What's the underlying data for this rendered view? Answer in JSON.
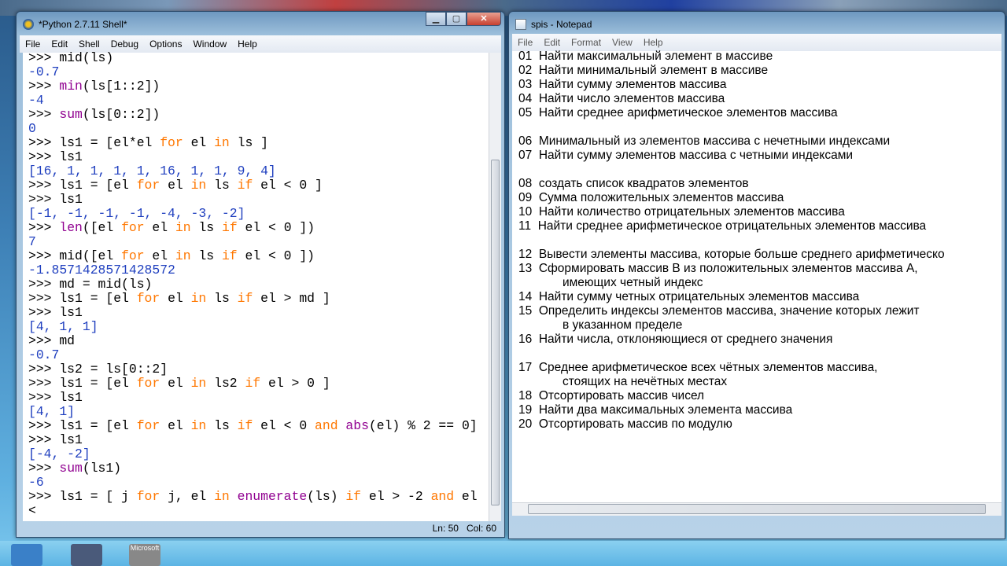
{
  "shell": {
    "title": "*Python 2.7.11 Shell*",
    "menu": [
      "File",
      "Edit",
      "Shell",
      "Debug",
      "Options",
      "Window",
      "Help"
    ],
    "lines": [
      [
        [
          "n",
          ">>> mid(ls)"
        ]
      ],
      [
        [
          "o",
          "-0.7"
        ]
      ],
      [
        [
          "n",
          ">>> "
        ],
        [
          "b",
          "min"
        ],
        [
          "n",
          "(ls[1::2])"
        ]
      ],
      [
        [
          "o",
          "-4"
        ]
      ],
      [
        [
          "n",
          ">>> "
        ],
        [
          "b",
          "sum"
        ],
        [
          "n",
          "(ls[0::2])"
        ]
      ],
      [
        [
          "o",
          "0"
        ]
      ],
      [
        [
          "n",
          ">>> ls1 = [el*el "
        ],
        [
          "k",
          "for"
        ],
        [
          "n",
          " el "
        ],
        [
          "k",
          "in"
        ],
        [
          "n",
          " ls ]"
        ]
      ],
      [
        [
          "n",
          ">>> ls1"
        ]
      ],
      [
        [
          "o",
          "[16, 1, 1, 1, 1, 16, 1, 1, 9, 4]"
        ]
      ],
      [
        [
          "n",
          ">>> ls1 = [el "
        ],
        [
          "k",
          "for"
        ],
        [
          "n",
          " el "
        ],
        [
          "k",
          "in"
        ],
        [
          "n",
          " ls "
        ],
        [
          "k",
          "if"
        ],
        [
          "n",
          " el < 0 ]"
        ]
      ],
      [
        [
          "n",
          ">>> ls1"
        ]
      ],
      [
        [
          "o",
          "[-1, -1, -1, -1, -4, -3, -2]"
        ]
      ],
      [
        [
          "n",
          ">>> "
        ],
        [
          "b",
          "len"
        ],
        [
          "n",
          "([el "
        ],
        [
          "k",
          "for"
        ],
        [
          "n",
          " el "
        ],
        [
          "k",
          "in"
        ],
        [
          "n",
          " ls "
        ],
        [
          "k",
          "if"
        ],
        [
          "n",
          " el < 0 ])"
        ]
      ],
      [
        [
          "o",
          "7"
        ]
      ],
      [
        [
          "n",
          ">>> mid([el "
        ],
        [
          "k",
          "for"
        ],
        [
          "n",
          " el "
        ],
        [
          "k",
          "in"
        ],
        [
          "n",
          " ls "
        ],
        [
          "k",
          "if"
        ],
        [
          "n",
          " el < 0 ])"
        ]
      ],
      [
        [
          "o",
          "-1.8571428571428572"
        ]
      ],
      [
        [
          "n",
          ">>> md = mid(ls)"
        ]
      ],
      [
        [
          "n",
          ">>> ls1 = [el "
        ],
        [
          "k",
          "for"
        ],
        [
          "n",
          " el "
        ],
        [
          "k",
          "in"
        ],
        [
          "n",
          " ls "
        ],
        [
          "k",
          "if"
        ],
        [
          "n",
          " el > md ]"
        ]
      ],
      [
        [
          "n",
          ">>> ls1"
        ]
      ],
      [
        [
          "o",
          "[4, 1, 1]"
        ]
      ],
      [
        [
          "n",
          ">>> md"
        ]
      ],
      [
        [
          "o",
          "-0.7"
        ]
      ],
      [
        [
          "n",
          ">>> ls2 = ls[0::2]"
        ]
      ],
      [
        [
          "n",
          ">>> ls1 = [el "
        ],
        [
          "k",
          "for"
        ],
        [
          "n",
          " el "
        ],
        [
          "k",
          "in"
        ],
        [
          "n",
          " ls2 "
        ],
        [
          "k",
          "if"
        ],
        [
          "n",
          " el > 0 ]"
        ]
      ],
      [
        [
          "n",
          ">>> ls1"
        ]
      ],
      [
        [
          "o",
          "[4, 1]"
        ]
      ],
      [
        [
          "n",
          ">>> ls1 = [el "
        ],
        [
          "k",
          "for"
        ],
        [
          "n",
          " el "
        ],
        [
          "k",
          "in"
        ],
        [
          "n",
          " ls "
        ],
        [
          "k",
          "if"
        ],
        [
          "n",
          " el < 0 "
        ],
        [
          "k",
          "and"
        ],
        [
          "n",
          " "
        ],
        [
          "b",
          "abs"
        ],
        [
          "n",
          "(el) % 2 == 0]"
        ]
      ],
      [
        [
          "n",
          ">>> ls1"
        ]
      ],
      [
        [
          "o",
          "[-4, -2]"
        ]
      ],
      [
        [
          "n",
          ">>> "
        ],
        [
          "b",
          "sum"
        ],
        [
          "n",
          "(ls1)"
        ]
      ],
      [
        [
          "o",
          "-6"
        ]
      ],
      [
        [
          "n",
          ">>> ls1 = [ j "
        ],
        [
          "k",
          "for"
        ],
        [
          "n",
          " j, el "
        ],
        [
          "k",
          "in"
        ],
        [
          "n",
          " "
        ],
        [
          "b",
          "enumerate"
        ],
        [
          "n",
          "(ls) "
        ],
        [
          "k",
          "if"
        ],
        [
          "n",
          " el > -2 "
        ],
        [
          "k",
          "and"
        ],
        [
          "n",
          " el"
        ]
      ],
      [
        [
          "n",
          "<"
        ]
      ]
    ],
    "status": {
      "ln": "Ln: 50",
      "col": "Col: 60"
    }
  },
  "notepad": {
    "title": "spis - Notepad",
    "menu": [
      "File",
      "Edit",
      "Format",
      "View",
      "Help"
    ],
    "lines": [
      "01  Найти максимальный элемент в массиве",
      "02  Найти минимальный элемент в массиве",
      "03  Найти сумму элементов массива",
      "04  Найти число элементов массива",
      "05  Найти среднее арифметическое элементов массива",
      "",
      "06  Минимальный из элементов массива с нечетными индексами",
      "07  Найти сумму элементов массива с четными индексами",
      "",
      "08  создать список квадратов элементов",
      "09  Сумма положительных элементов массива",
      "10  Найти количество отрицательных элементов массива",
      "11  Найти среднее арифметическое отрицательных элементов массива",
      "",
      "12  Вывести элементы массива, которые больше среднего арифметическо",
      "13  Сформировать массив В из положительных элементов массива А,",
      "             имеющих четный индекс",
      "14  Найти сумму четных отрицательных элементов массива",
      "15  Определить индексы элементов массива, значение которых лежит",
      "             в указанном пределе",
      "16  Найти числа, отклоняющиеся от среднего значения",
      "",
      "17  Среднее арифметическое всех чётных элементов массива,",
      "             стоящих на нечётных местах",
      "18  Отсортировать массив чисел",
      "19  Найти два максимальных элемента массива",
      "20  Отсортировать массив по модулю"
    ]
  },
  "taskbar": {
    "items": [
      "Microsoft"
    ]
  }
}
